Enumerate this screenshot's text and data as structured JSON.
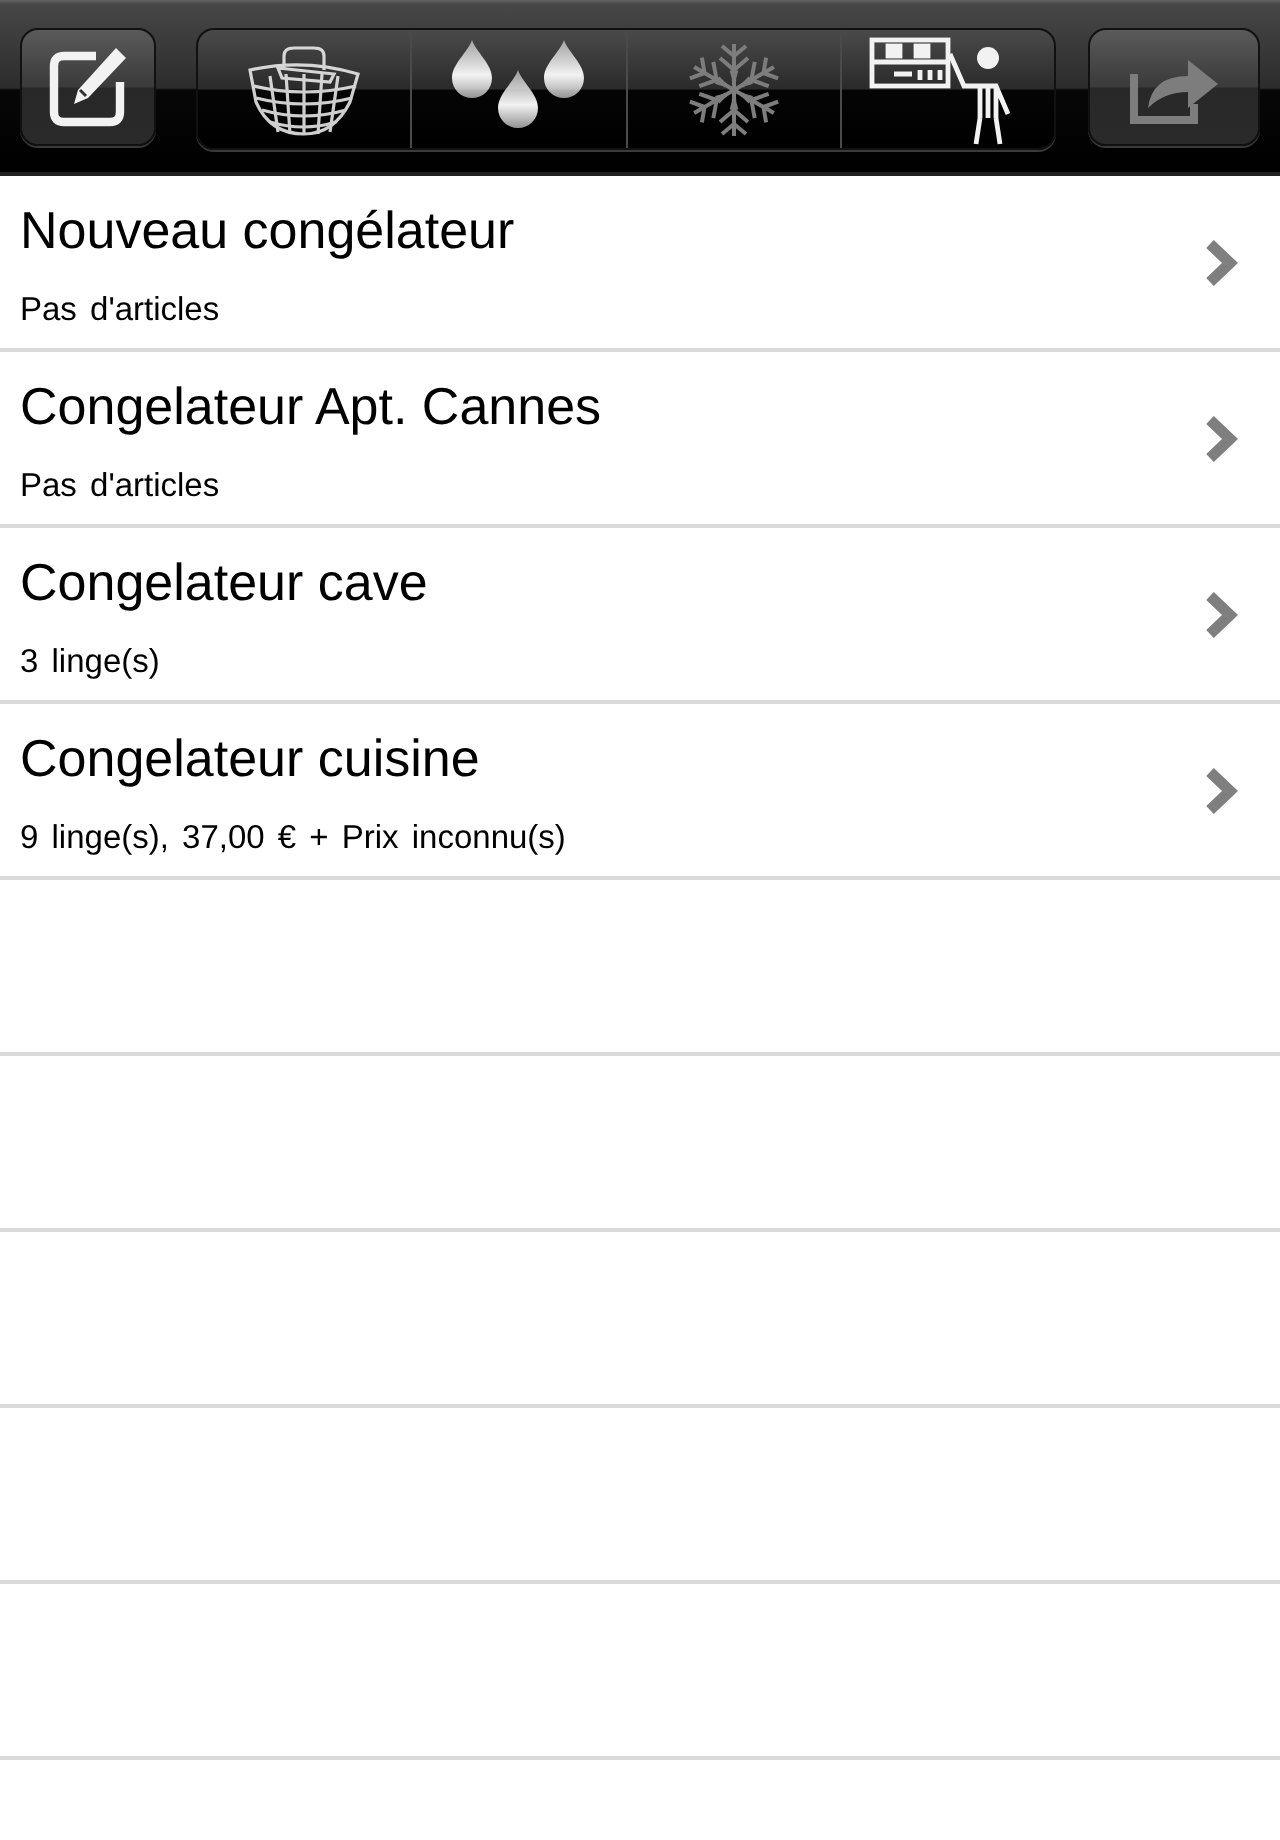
{
  "toolbar": {
    "edit_button": {
      "disabled": false
    },
    "segments": [
      {
        "disabled": false
      },
      {
        "disabled": false
      },
      {
        "disabled": true
      },
      {
        "disabled": false
      }
    ],
    "share_button": {
      "disabled": true
    }
  },
  "freezers": [
    {
      "title": "Nouveau congélateur",
      "subtitle": "Pas d'articles"
    },
    {
      "title": "Congelateur Apt. Cannes",
      "subtitle": "Pas d'articles"
    },
    {
      "title": "Congelateur cave",
      "subtitle": "3 linge(s)"
    },
    {
      "title": "Congelateur cuisine",
      "subtitle": "9 linge(s), 37,00 € + Prix inconnu(s)"
    }
  ]
}
